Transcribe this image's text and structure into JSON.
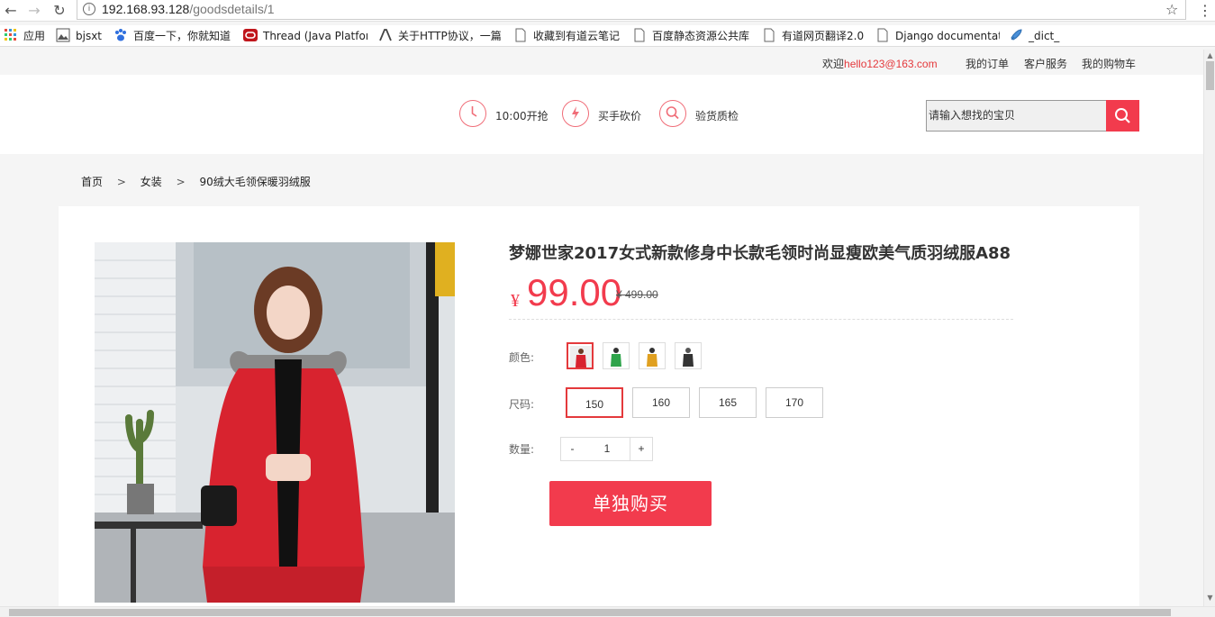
{
  "browser": {
    "url_host": "192.168.93.128",
    "url_path": "/goodsdetails/1",
    "bookmarks": [
      "应用",
      "bjsxt",
      "百度一下，你就知道",
      "Thread (Java Platfor",
      "关于HTTP协议，一篇",
      "收藏到有道云笔记",
      "百度静态资源公共库",
      "有道网页翻译2.0",
      "Django documentat",
      "_dict_"
    ]
  },
  "topbar": {
    "welcome": "欢迎",
    "user": "hello123@163.com",
    "orders": "我的订单",
    "service": "客户服务",
    "cart": "我的购物车"
  },
  "header": {
    "features": [
      "10:00开抢",
      "买手砍价",
      "验货质检"
    ],
    "search_placeholder": "请输入想找的宝贝"
  },
  "breadcrumb": {
    "home": "首页",
    "sep": ">",
    "category": "女装",
    "current": "90绒大毛领保暖羽绒服"
  },
  "product": {
    "title": "梦娜世家2017女式新款修身中长款毛领时尚显瘦欧美气质羽绒服A88",
    "currency": "¥",
    "price": "99.00",
    "old_price": "¥ 499.00",
    "color_label": "颜色:",
    "colors": [
      "#d8232f",
      "#2fa44b",
      "#e0a020",
      "#333333"
    ],
    "size_label": "尺码:",
    "sizes": [
      "150",
      "160",
      "165",
      "170"
    ],
    "qty_label": "数量:",
    "qty_minus": "-",
    "qty_value": "1",
    "qty_plus": "+",
    "buy_label": "单独购买"
  },
  "colors": {
    "accent": "#f23b4d",
    "link": "#e4393c"
  }
}
